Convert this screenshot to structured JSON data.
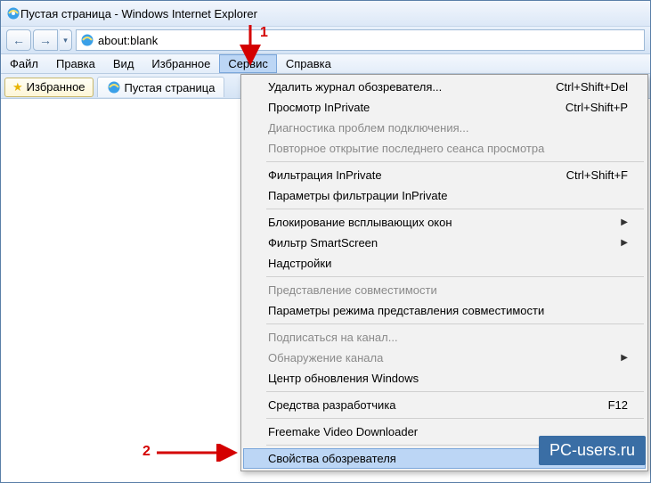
{
  "titlebar": {
    "title": "Пустая страница - Windows Internet Explorer"
  },
  "address": {
    "url": "about:blank"
  },
  "menubar": {
    "items": [
      "Файл",
      "Правка",
      "Вид",
      "Избранное",
      "Сервис",
      "Справка"
    ],
    "active_index": 4
  },
  "favorites_button": "Избранное",
  "tab": {
    "title": "Пустая страница"
  },
  "dropdown": {
    "items": [
      {
        "label": "Удалить журнал обозревателя...",
        "shortcut": "Ctrl+Shift+Del",
        "disabled": false
      },
      {
        "label": "Просмотр InPrivate",
        "shortcut": "Ctrl+Shift+P",
        "disabled": false
      },
      {
        "label": "Диагностика проблем подключения...",
        "shortcut": "",
        "disabled": true
      },
      {
        "label": "Повторное открытие последнего сеанса просмотра",
        "shortcut": "",
        "disabled": true
      },
      {
        "sep": true
      },
      {
        "label": "Фильтрация InPrivate",
        "shortcut": "Ctrl+Shift+F",
        "disabled": false
      },
      {
        "label": "Параметры фильтрации InPrivate",
        "shortcut": "",
        "disabled": false
      },
      {
        "sep": true
      },
      {
        "label": "Блокирование всплывающих окон",
        "shortcut": "",
        "submenu": true,
        "disabled": false
      },
      {
        "label": "Фильтр SmartScreen",
        "shortcut": "",
        "submenu": true,
        "disabled": false
      },
      {
        "label": "Надстройки",
        "shortcut": "",
        "disabled": false
      },
      {
        "sep": true
      },
      {
        "label": "Представление совместимости",
        "shortcut": "",
        "disabled": true
      },
      {
        "label": "Параметры режима представления совместимости",
        "shortcut": "",
        "disabled": false
      },
      {
        "sep": true
      },
      {
        "label": "Подписаться на канал...",
        "shortcut": "",
        "disabled": true
      },
      {
        "label": "Обнаружение канала",
        "shortcut": "",
        "submenu": true,
        "disabled": true
      },
      {
        "label": "Центр обновления Windows",
        "shortcut": "",
        "disabled": false
      },
      {
        "sep": true
      },
      {
        "label": "Средства разработчика",
        "shortcut": "F12",
        "disabled": false
      },
      {
        "sep": true
      },
      {
        "label": "Freemake Video Downloader",
        "shortcut": "",
        "disabled": false
      },
      {
        "sep": true
      },
      {
        "label": "Свойства обозревателя",
        "shortcut": "",
        "disabled": false,
        "highlight": true
      }
    ]
  },
  "annotations": {
    "num1": "1",
    "num2": "2"
  },
  "watermark": "PC-users.ru"
}
